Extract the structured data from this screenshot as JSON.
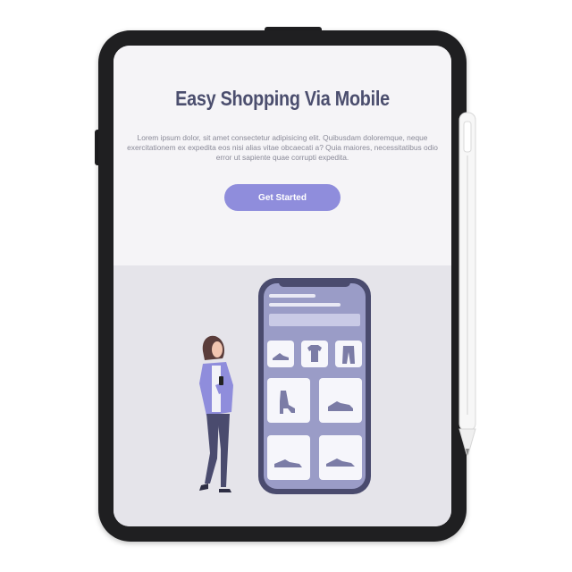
{
  "hero": {
    "title": "Easy Shopping Via Mobile",
    "description": "Lorem ipsum dolor, sit amet consectetur adipisicing elit. Quibusdam doloremque, neque exercitationem ex expedita eos nisi alias vitae obcaecati a? Quia maiores, necessitatibus odio error ut sapiente quae corrupti expedita.",
    "cta_label": "Get Started"
  },
  "colors": {
    "accent": "#8f8ddc",
    "title": "#4b4e6e",
    "device_frame": "#1f1f21",
    "illustration_bg": "#e5e4ea",
    "phone_screen": "#9a9cc7"
  },
  "illustration": {
    "phone_icons": [
      "sneaker-icon",
      "tshirt-icon",
      "pants-icon",
      "high-heel-icon",
      "shoe-icon",
      "sneaker-icon",
      "shoe-icon"
    ]
  }
}
